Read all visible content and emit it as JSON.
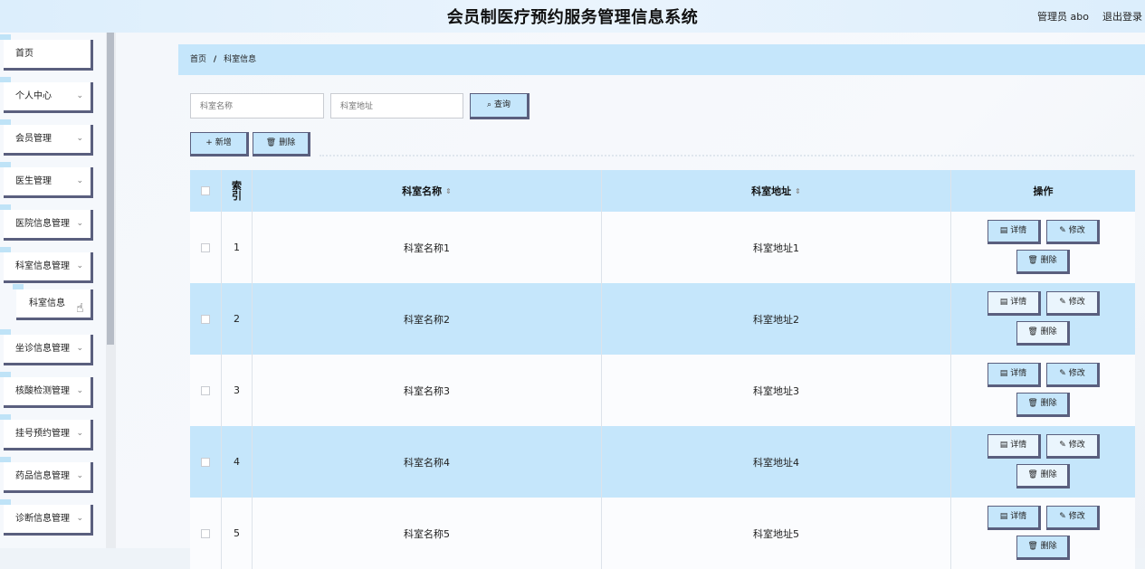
{
  "header": {
    "title": "会员制医疗预约服务管理信息系统",
    "user": "管理员 abo",
    "logout": "退出登录"
  },
  "sidebar": {
    "items": [
      {
        "label": "首页",
        "has_chevron": false
      },
      {
        "label": "个人中心",
        "has_chevron": true
      },
      {
        "label": "会员管理",
        "has_chevron": true
      },
      {
        "label": "医生管理",
        "has_chevron": true
      },
      {
        "label": "医院信息管理",
        "has_chevron": true
      },
      {
        "label": "科室信息管理",
        "has_chevron": true
      },
      {
        "label": "科室信息",
        "sub": true
      },
      {
        "label": "坐诊信息管理",
        "has_chevron": true
      },
      {
        "label": "核酸检测管理",
        "has_chevron": true
      },
      {
        "label": "挂号预约管理",
        "has_chevron": true
      },
      {
        "label": "药品信息管理",
        "has_chevron": true
      },
      {
        "label": "诊断信息管理",
        "has_chevron": true
      }
    ],
    "chevron": "⌄"
  },
  "breadcrumb": {
    "home": "首页",
    "sep": "/",
    "current": "科室信息"
  },
  "search": {
    "name_placeholder": "科室名称",
    "address_placeholder": "科室地址",
    "query_label": "查询",
    "query_icon": "⌕"
  },
  "toolbar": {
    "add_icon": "+",
    "add_label": "新增",
    "delete_icon": "🗑",
    "delete_label": "删除"
  },
  "table": {
    "headers": {
      "index": "索引",
      "name": "科室名称",
      "address": "科室地址",
      "ops": "操作",
      "sort_icon": "⇕"
    },
    "rows": [
      {
        "index": "1",
        "name": "科室名称1",
        "address": "科室地址1"
      },
      {
        "index": "2",
        "name": "科室名称2",
        "address": "科室地址2"
      },
      {
        "index": "3",
        "name": "科室名称3",
        "address": "科室地址3"
      },
      {
        "index": "4",
        "name": "科室名称4",
        "address": "科室地址4"
      },
      {
        "index": "5",
        "name": "科室名称5",
        "address": "科室地址5"
      }
    ],
    "row_buttons": {
      "detail_icon": "▤",
      "detail": "详情",
      "edit_icon": "✎",
      "edit": "修改",
      "delete_icon": "🗑",
      "delete": "删除"
    }
  },
  "colors": {
    "accent": "#c5e6fb",
    "button_border": "#5a5f7e"
  }
}
